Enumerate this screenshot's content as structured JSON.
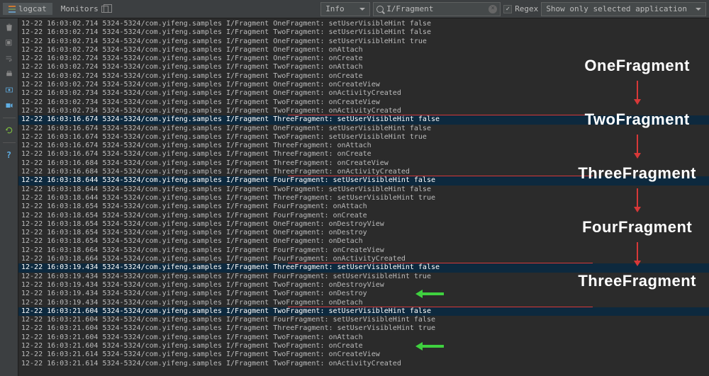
{
  "toolbar": {
    "logcat_tab": "logcat",
    "monitors_tab": "Monitors",
    "level_selector": "Info",
    "search_value": "I/Fragment",
    "regex_label": "Regex",
    "filter_selector": "Show only selected application"
  },
  "log_prefix": {
    "date": "12-22",
    "pid_tid": "5324-5324",
    "pkg": "com.yifeng.samples",
    "tag": "I/Fragment"
  },
  "log_lines": [
    {
      "t": "16:03:02.714",
      "f": "OneFragment",
      "m": "setUserVisibleHint false",
      "sel": false,
      "grp": 0
    },
    {
      "t": "16:03:02.714",
      "f": "TwoFragment",
      "m": "setUserVisibleHint false",
      "sel": false,
      "grp": 0
    },
    {
      "t": "16:03:02.714",
      "f": "OneFragment",
      "m": "setUserVisibleHint true",
      "sel": false,
      "grp": 0
    },
    {
      "t": "16:03:02.724",
      "f": "OneFragment",
      "m": "onAttach",
      "sel": false,
      "grp": 0
    },
    {
      "t": "16:03:02.724",
      "f": "OneFragment",
      "m": "onCreate",
      "sel": false,
      "grp": 0
    },
    {
      "t": "16:03:02.724",
      "f": "TwoFragment",
      "m": "onAttach",
      "sel": false,
      "grp": 0
    },
    {
      "t": "16:03:02.724",
      "f": "TwoFragment",
      "m": "onCreate",
      "sel": false,
      "grp": 0
    },
    {
      "t": "16:03:02.724",
      "f": "OneFragment",
      "m": "onCreateView",
      "sel": false,
      "grp": 0
    },
    {
      "t": "16:03:02.734",
      "f": "OneFragment",
      "m": "onActivityCreated",
      "sel": false,
      "grp": 0
    },
    {
      "t": "16:03:02.734",
      "f": "TwoFragment",
      "m": "onCreateView",
      "sel": false,
      "grp": 0
    },
    {
      "t": "16:03:02.734",
      "f": "TwoFragment",
      "m": "onActivityCreated",
      "sel": false,
      "grp": 0,
      "redline_after": true
    },
    {
      "t": "16:03:16.674",
      "f": "ThreeFragment",
      "m": "setUserVisibleHint false",
      "sel": true,
      "grp": 1
    },
    {
      "t": "16:03:16.674",
      "f": "OneFragment",
      "m": "setUserVisibleHint false",
      "sel": false,
      "grp": 1
    },
    {
      "t": "16:03:16.674",
      "f": "TwoFragment",
      "m": "setUserVisibleHint true",
      "sel": false,
      "grp": 1
    },
    {
      "t": "16:03:16.674",
      "f": "ThreeFragment",
      "m": "onAttach",
      "sel": false,
      "grp": 1
    },
    {
      "t": "16:03:16.674",
      "f": "ThreeFragment",
      "m": "onCreate",
      "sel": false,
      "grp": 1
    },
    {
      "t": "16:03:16.684",
      "f": "ThreeFragment",
      "m": "onCreateView",
      "sel": false,
      "grp": 1
    },
    {
      "t": "16:03:16.684",
      "f": "ThreeFragment",
      "m": "onActivityCreated",
      "sel": false,
      "grp": 1,
      "redline_after": true
    },
    {
      "t": "16:03:18.644",
      "f": "FourFragment",
      "m": "setUserVisibleHint false",
      "sel": true,
      "grp": 2
    },
    {
      "t": "16:03:18.644",
      "f": "TwoFragment",
      "m": "setUserVisibleHint false",
      "sel": false,
      "grp": 2
    },
    {
      "t": "16:03:18.644",
      "f": "ThreeFragment",
      "m": "setUserVisibleHint true",
      "sel": false,
      "grp": 2
    },
    {
      "t": "16:03:18.654",
      "f": "FourFragment",
      "m": "onAttach",
      "sel": false,
      "grp": 2
    },
    {
      "t": "16:03:18.654",
      "f": "FourFragment",
      "m": "onCreate",
      "sel": false,
      "grp": 2
    },
    {
      "t": "16:03:18.654",
      "f": "OneFragment",
      "m": "onDestroyView",
      "sel": false,
      "grp": 2
    },
    {
      "t": "16:03:18.654",
      "f": "OneFragment",
      "m": "onDestroy",
      "sel": false,
      "grp": 2
    },
    {
      "t": "16:03:18.654",
      "f": "OneFragment",
      "m": "onDetach",
      "sel": false,
      "grp": 2
    },
    {
      "t": "16:03:18.664",
      "f": "FourFragment",
      "m": "onCreateView",
      "sel": false,
      "grp": 2
    },
    {
      "t": "16:03:18.664",
      "f": "FourFragment",
      "m": "onActivityCreated",
      "sel": false,
      "grp": 2,
      "redline_after": true
    },
    {
      "t": "16:03:19.434",
      "f": "ThreeFragment",
      "m": "setUserVisibleHint false",
      "sel": true,
      "grp": 3
    },
    {
      "t": "16:03:19.434",
      "f": "FourFragment",
      "m": "setUserVisibleHint true",
      "sel": false,
      "grp": 3
    },
    {
      "t": "16:03:19.434",
      "f": "TwoFragment",
      "m": "onDestroyView",
      "sel": false,
      "grp": 3
    },
    {
      "t": "16:03:19.434",
      "f": "TwoFragment",
      "m": "onDestroy",
      "sel": false,
      "grp": 3,
      "arrow": true
    },
    {
      "t": "16:03:19.434",
      "f": "TwoFragment",
      "m": "onDetach",
      "sel": false,
      "grp": 3,
      "redline_after": true
    },
    {
      "t": "16:03:21.604",
      "f": "TwoFragment",
      "m": "setUserVisibleHint false",
      "sel": true,
      "grp": 4
    },
    {
      "t": "16:03:21.604",
      "f": "FourFragment",
      "m": "setUserVisibleHint false",
      "sel": false,
      "grp": 4
    },
    {
      "t": "16:03:21.604",
      "f": "ThreeFragment",
      "m": "setUserVisibleHint true",
      "sel": false,
      "grp": 4
    },
    {
      "t": "16:03:21.604",
      "f": "TwoFragment",
      "m": "onAttach",
      "sel": false,
      "grp": 4
    },
    {
      "t": "16:03:21.604",
      "f": "TwoFragment",
      "m": "onCreate",
      "sel": false,
      "grp": 4,
      "arrow": true
    },
    {
      "t": "16:03:21.614",
      "f": "TwoFragment",
      "m": "onCreateView",
      "sel": false,
      "grp": 4
    },
    {
      "t": "16:03:21.614",
      "f": "TwoFragment",
      "m": "onActivityCreated",
      "sel": false,
      "grp": 4
    }
  ],
  "labels": [
    "OneFragment",
    "TwoFragment",
    "ThreeFragment",
    "FourFragment",
    "ThreeFragment"
  ]
}
